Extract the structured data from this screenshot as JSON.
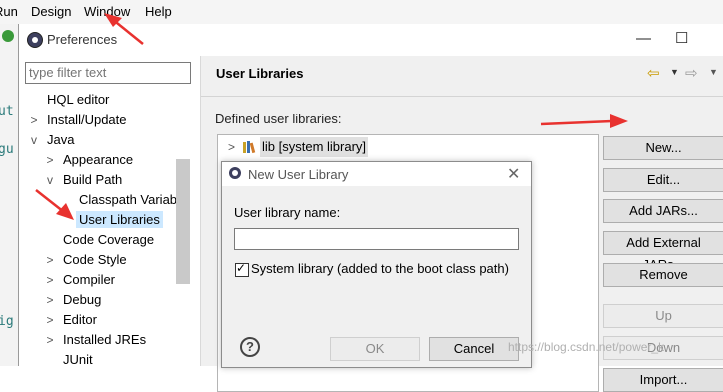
{
  "menubar": {
    "items": [
      "Run",
      "Design",
      "Window",
      "Help"
    ]
  },
  "ide": {
    "code_lines": [
      "ut",
      "gu",
      "ig"
    ]
  },
  "preferences": {
    "title": "Preferences",
    "filter_placeholder": "type filter text",
    "tree": [
      {
        "label": "HQL editor",
        "expander": ""
      },
      {
        "label": "Install/Update",
        "expander": ">"
      },
      {
        "label": "Java",
        "expander": "v"
      },
      {
        "label": "Appearance",
        "expander": ">"
      },
      {
        "label": "Build Path",
        "expander": "v"
      },
      {
        "label": "Classpath Variab",
        "expander": ""
      },
      {
        "label": "User Libraries",
        "expander": "",
        "selected": true
      },
      {
        "label": "Code Coverage",
        "expander": ""
      },
      {
        "label": "Code Style",
        "expander": ">"
      },
      {
        "label": "Compiler",
        "expander": ">"
      },
      {
        "label": "Debug",
        "expander": ">"
      },
      {
        "label": "Editor",
        "expander": ">"
      },
      {
        "label": "Installed JREs",
        "expander": ">"
      },
      {
        "label": "JUnit",
        "expander": ""
      }
    ],
    "page_title": "User Libraries",
    "defined_label": "Defined user libraries:",
    "libraries": [
      {
        "label": "lib [system library]",
        "expander": ">"
      }
    ],
    "buttons": {
      "new": "New...",
      "edit": "Edit...",
      "add_jars": "Add JARs...",
      "add_external_jars": "Add External JARs...",
      "remove": "Remove",
      "up": "Up",
      "down": "Down",
      "import": "Import..."
    },
    "window_controls": {
      "minimize": "—",
      "maximize": "☐"
    }
  },
  "new_user_library": {
    "title": "New User Library",
    "name_label": "User library name:",
    "name_value": "",
    "system_library_label": "System library (added to the boot class path)",
    "system_library_checked": true,
    "ok": "OK",
    "cancel": "Cancel",
    "close": "✕",
    "help": "?"
  },
  "watermark": "https://blog.csdn.net/power_k"
}
